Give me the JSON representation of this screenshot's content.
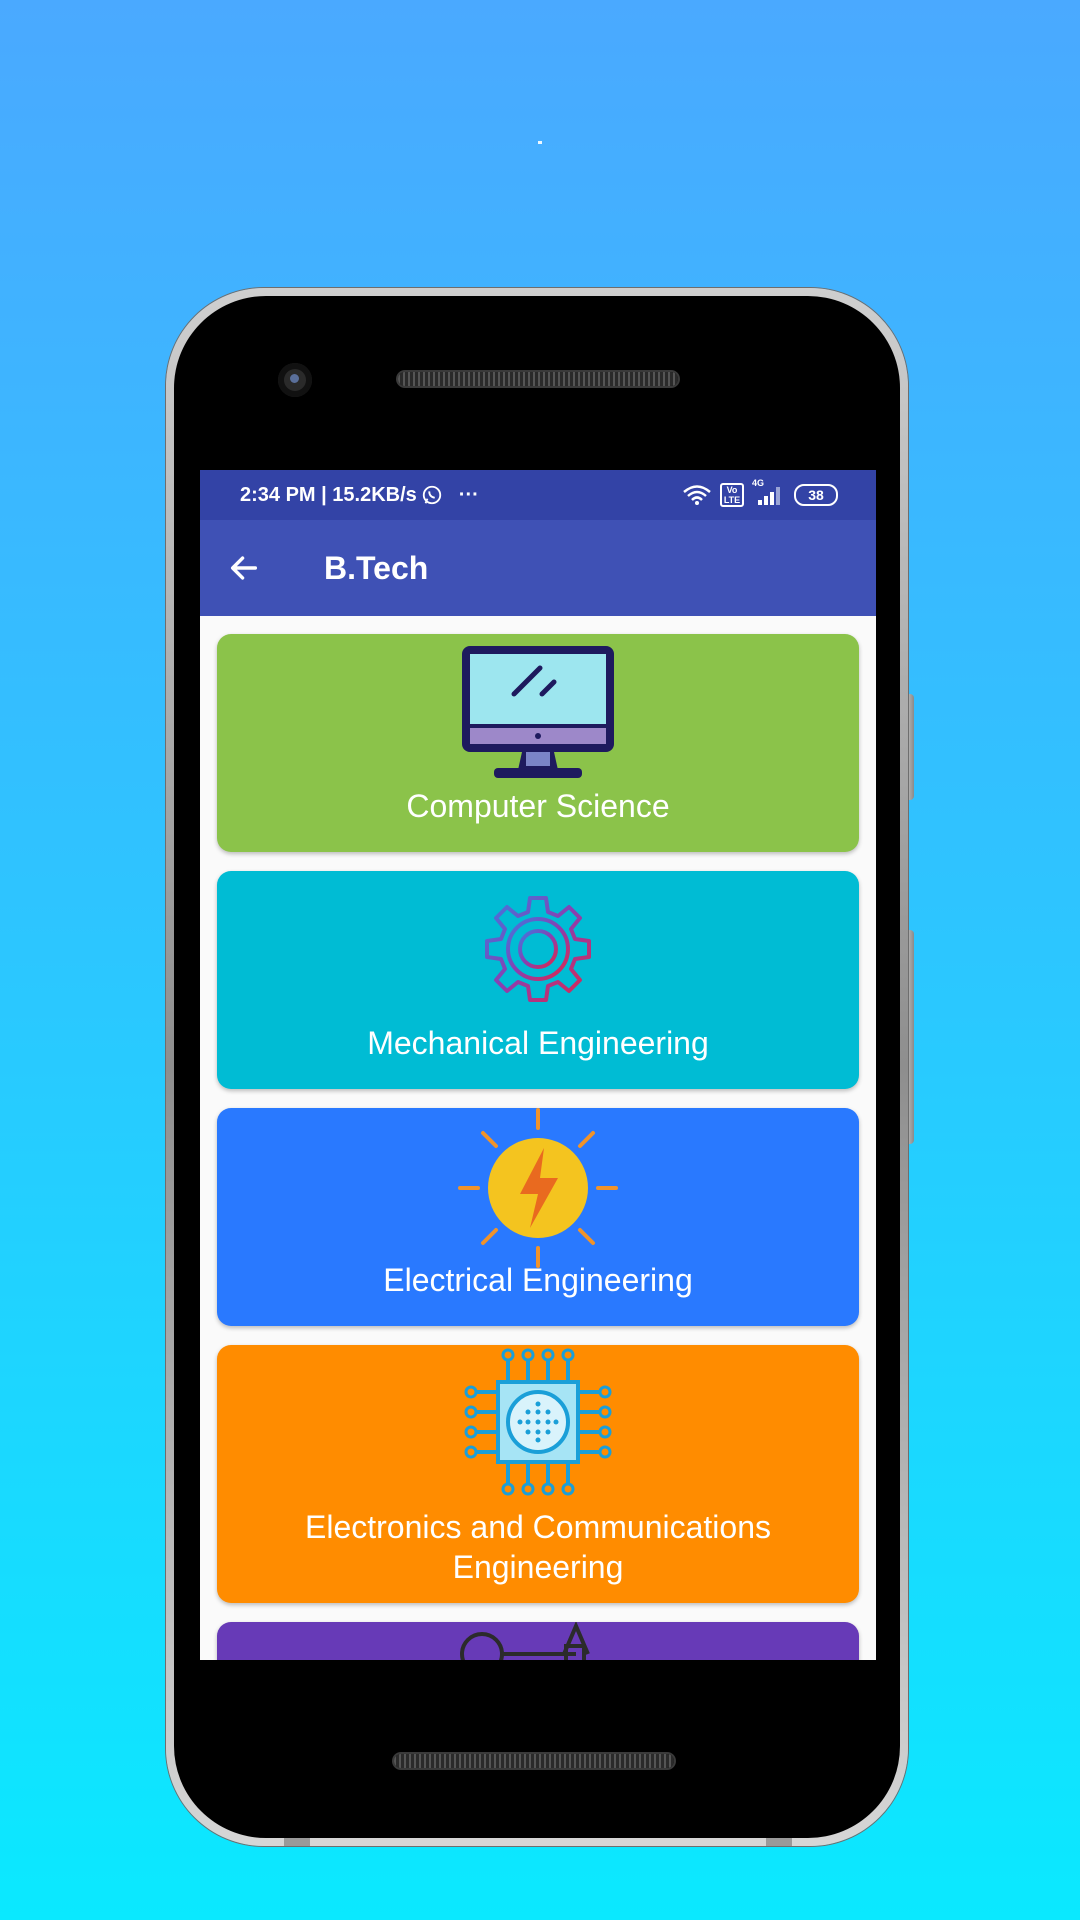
{
  "status_bar": {
    "time_speed": "2:34 PM | 15.2KB/s",
    "overflow": "···",
    "network_badge": "Vo LTE",
    "network_type": "4G",
    "battery": "38"
  },
  "toolbar": {
    "title": "B.Tech"
  },
  "courses": [
    {
      "label": "Computer Science",
      "color": "#8bc34a",
      "icon": "computer-monitor-icon"
    },
    {
      "label": "Mechanical Engineering",
      "color": "#00bcd4",
      "icon": "gear-icon"
    },
    {
      "label": "Electrical Engineering",
      "color": "#2979ff",
      "icon": "lightning-sun-icon"
    },
    {
      "label": "Electronics and Communications Engineering",
      "color": "#ff8c00",
      "icon": "circuit-chip-icon"
    },
    {
      "label": "",
      "color": "#673ab7",
      "icon": "civil-tools-icon"
    }
  ],
  "colors": {
    "status_bar": "#3343a6",
    "toolbar": "#3f51b5",
    "background_top": "#4aa9ff",
    "background_bottom": "#0ae9ff"
  }
}
